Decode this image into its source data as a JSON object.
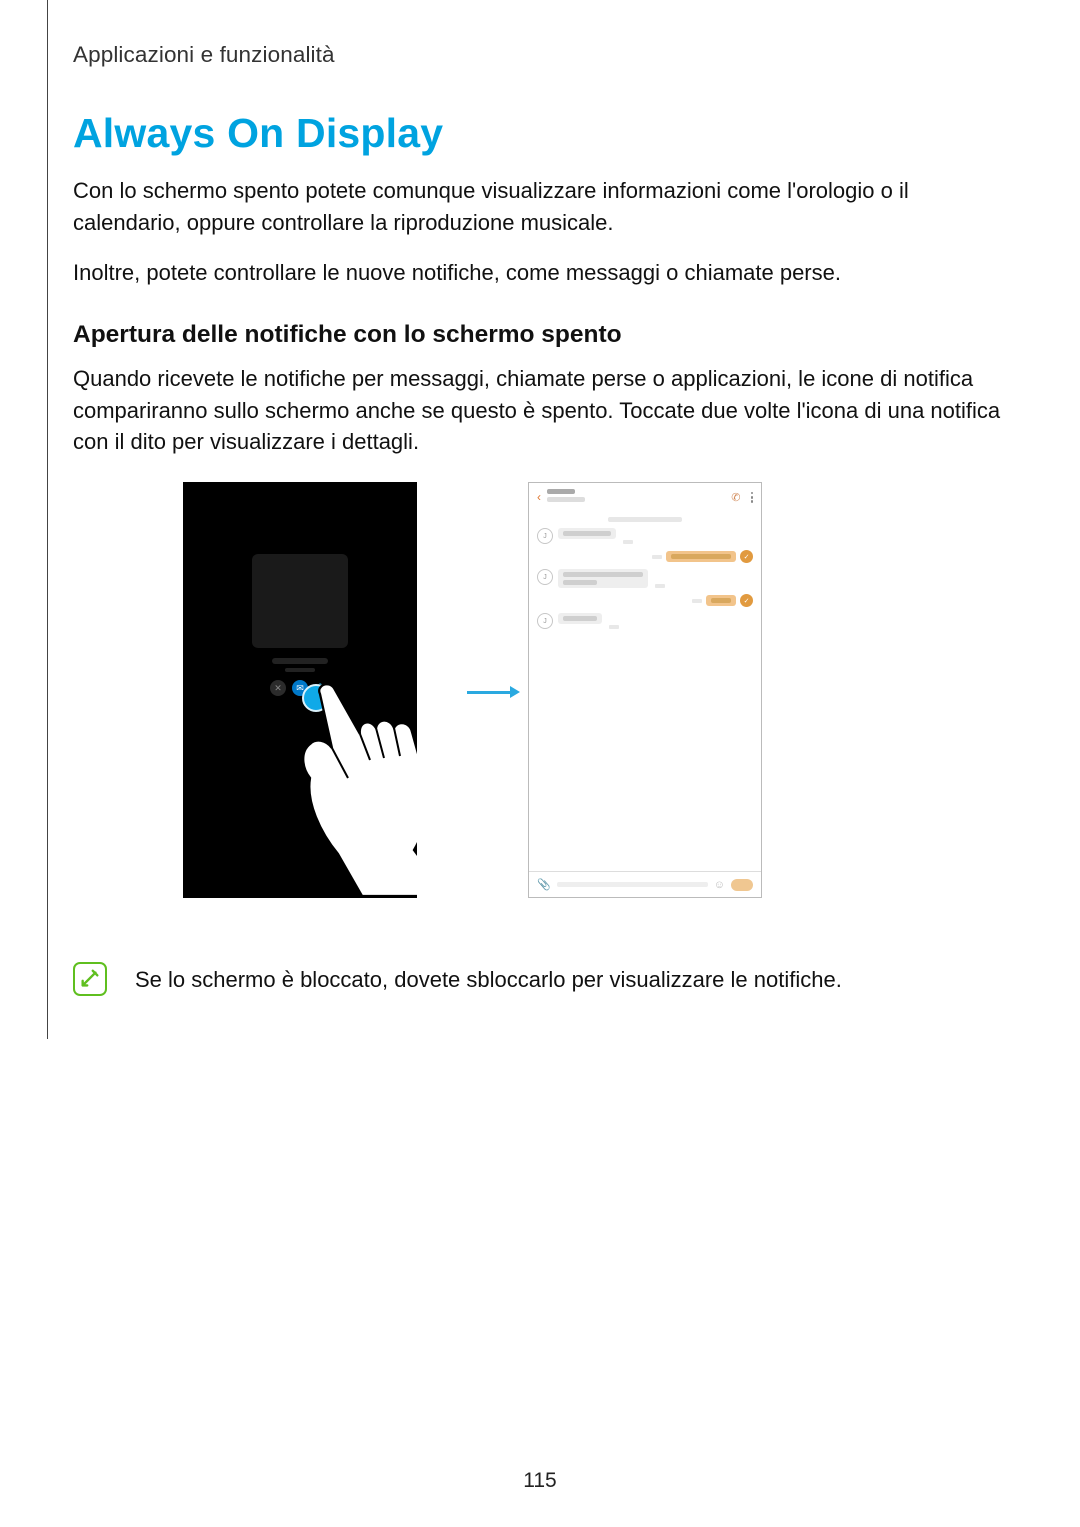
{
  "page": {
    "running_head": "Applicazioni e funzionalità",
    "number": "115"
  },
  "title": "Always On Display",
  "paragraphs": {
    "p1": "Con lo schermo spento potete comunque visualizzare informazioni come l'orologio o il calendario, oppure controllare la riproduzione musicale.",
    "p2": "Inoltre, potete controllare le nuove notifiche, come messaggi o chiamate perse.",
    "p3": "Quando ricevete le notifiche per messaggi, chiamate perse o applicazioni, le icone di notifica compariranno sullo schermo anche se questo è spento. Toccate due volte l'icona di una notifica con il dito per visualizzare i dettagli."
  },
  "subheading": "Apertura delle notifiche con lo schermo spento",
  "note": "Se lo schermo è bloccato, dovete sbloccarlo per visualizzare le notifiche.",
  "figure": {
    "left_icons": [
      "alarm-icon",
      "message-icon",
      "pen-icon"
    ],
    "chat_avatar_initial": "J",
    "read_mark": "✓"
  },
  "colors": {
    "accent_heading": "#00a3e0",
    "arrow": "#2aa9e0",
    "note_green": "#5fbf1f",
    "chat_back": "#e07730",
    "chat_bubble_out": "#f2c48b",
    "read_dot": "#e19a3f"
  }
}
